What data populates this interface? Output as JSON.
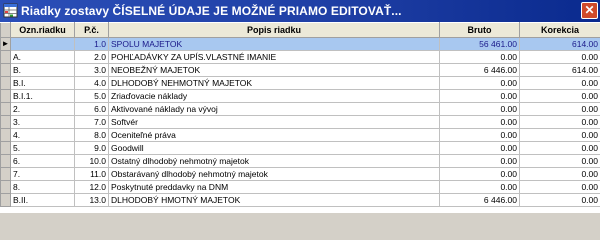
{
  "window": {
    "title": "Riadky zostavy  ČÍSELNÉ ÚDAJE JE MOŽNÉ PRIAMO EDITOVAŤ...",
    "close_icon": "close-icon",
    "app_icon": "table-icon"
  },
  "grid": {
    "columns": [
      "Ozn.riadku",
      "P.č.",
      "Popis riadku",
      "Bruto",
      "Korekcia"
    ],
    "selected_indicator": "►",
    "rows": [
      {
        "ozn": "",
        "pc": "1.0",
        "popis": "SPOLU MAJETOK",
        "bruto": "56 461.00",
        "korekcia": "614.00",
        "selected": true
      },
      {
        "ozn": "A.",
        "pc": "2.0",
        "popis": "POHĽADÁVKY ZA UPÍS.VLASTNÉ IMANIE",
        "bruto": "0.00",
        "korekcia": "0.00"
      },
      {
        "ozn": "B.",
        "pc": "3.0",
        "popis": "NEOBEŽNÝ MAJETOK",
        "bruto": "6 446.00",
        "korekcia": "614.00"
      },
      {
        "ozn": "B.I.",
        "pc": "4.0",
        "popis": "DLHODOBÝ NEHMOTNÝ MAJETOK",
        "bruto": "0.00",
        "korekcia": "0.00"
      },
      {
        "ozn": "B.I.1.",
        "pc": "5.0",
        "popis": "Zriaďovacie náklady",
        "bruto": "0.00",
        "korekcia": "0.00"
      },
      {
        "ozn": "2.",
        "pc": "6.0",
        "popis": "Aktivované náklady na vývoj",
        "bruto": "0.00",
        "korekcia": "0.00"
      },
      {
        "ozn": "3.",
        "pc": "7.0",
        "popis": "Softvér",
        "bruto": "0.00",
        "korekcia": "0.00"
      },
      {
        "ozn": "4.",
        "pc": "8.0",
        "popis": "Oceniteľné práva",
        "bruto": "0.00",
        "korekcia": "0.00"
      },
      {
        "ozn": "5.",
        "pc": "9.0",
        "popis": "Goodwill",
        "bruto": "0.00",
        "korekcia": "0.00"
      },
      {
        "ozn": "6.",
        "pc": "10.0",
        "popis": "Ostatný dlhodobý nehmotný majetok",
        "bruto": "0.00",
        "korekcia": "0.00"
      },
      {
        "ozn": "7.",
        "pc": "11.0",
        "popis": "Obstarávaný dlhodobý nehmotný majetok",
        "bruto": "0.00",
        "korekcia": "0.00"
      },
      {
        "ozn": "8.",
        "pc": "12.0",
        "popis": "Poskytnuté preddavky na DNM",
        "bruto": "0.00",
        "korekcia": "0.00"
      },
      {
        "ozn": "B.II.",
        "pc": "13.0",
        "popis": "DLHODOBÝ HMOTNÝ MAJETOK",
        "bruto": "6 446.00",
        "korekcia": "0.00"
      }
    ]
  }
}
